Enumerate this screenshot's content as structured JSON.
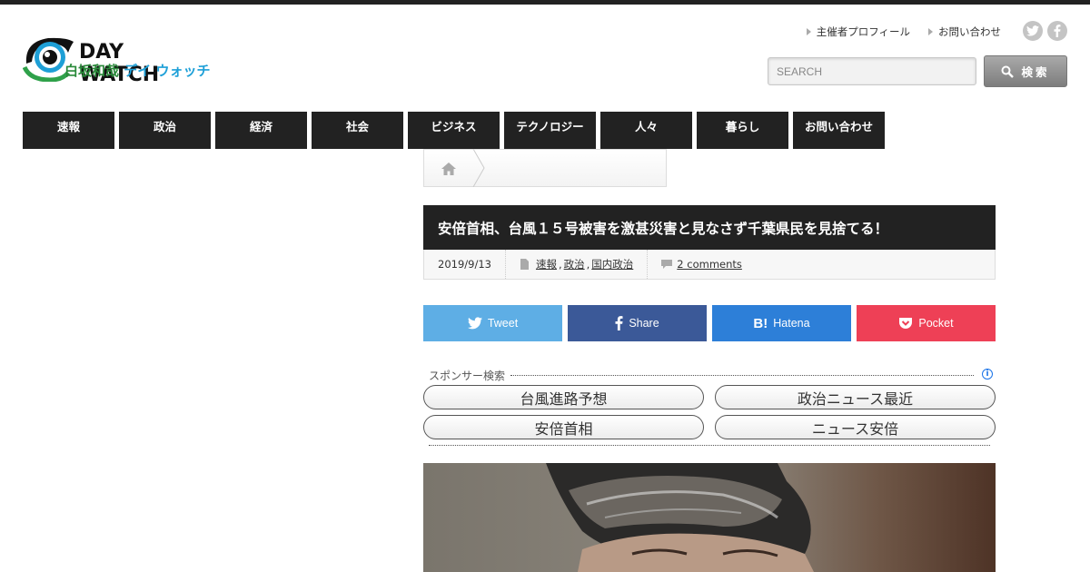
{
  "site": {
    "logo_en": "DAY WATCH",
    "logo_jp_part1": "白坂和哉",
    "logo_jp_part2": "デイ ウォッチ"
  },
  "header": {
    "links": [
      "主催者プロフィール",
      "お問い合わせ"
    ],
    "social": [
      {
        "name": "twitter",
        "glyph": "t"
      },
      {
        "name": "facebook",
        "glyph": "f"
      }
    ],
    "search_placeholder": "SEARCH",
    "search_button": "検索"
  },
  "nav": [
    "速報",
    "政治",
    "経済",
    "社会",
    "ビジネス",
    "テクノロジー",
    "人々",
    "暮らし",
    "お問い合わせ"
  ],
  "post": {
    "title": "安倍首相、台風１５号被害を激甚災害と見なさず千葉県民を見捨てる！",
    "date": "2019/9/13",
    "categories": [
      "速報",
      "政治",
      "国内政治"
    ],
    "comments": "2 comments"
  },
  "share": {
    "tweet": "Tweet",
    "share": "Share",
    "hatena": "Hatena",
    "pocket": "Pocket"
  },
  "sponsor": {
    "label": "スポンサー検索",
    "info_icon": "i",
    "links": [
      "台風進路予想",
      "政治ニュース最近",
      "安倍首相",
      "ニュース安倍"
    ]
  },
  "colors": {
    "nav_bg": "#222222",
    "twitter": "#5eaee5",
    "facebook": "#3b5998",
    "hatena": "#2d7fd8",
    "pocket": "#ee4056"
  }
}
